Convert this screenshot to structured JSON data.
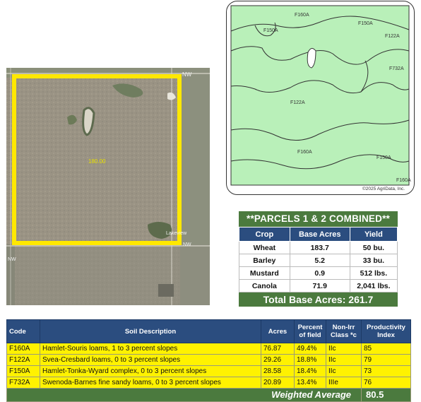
{
  "aerial": {
    "center_label": "180.00",
    "road_labels": [
      "NW",
      "Lakeview",
      "NW",
      "NW"
    ]
  },
  "soil_map": {
    "labels": [
      "F160A",
      "F150A",
      "F122A",
      "F150A",
      "F732A",
      "F122A",
      "F160A",
      "F150A",
      "F160A"
    ],
    "copyright": "©2025 AgriData, Inc."
  },
  "parcels": {
    "title": "**PARCELS 1 & 2 COMBINED**",
    "headers": [
      "Crop",
      "Base Acres",
      "Yield"
    ],
    "rows": [
      [
        "Wheat",
        "183.7",
        "50 bu."
      ],
      [
        "Barley",
        "5.2",
        "33 bu."
      ],
      [
        "Mustard",
        "0.9",
        "512 lbs."
      ],
      [
        "Canola",
        "71.9",
        "2,041 lbs."
      ]
    ],
    "total_label": "Total Base Acres:",
    "total_value": "261.7"
  },
  "soil_table": {
    "headers": {
      "code": "Code",
      "description": "Soil Description",
      "acres": "Acres",
      "percent_line1": "Percent",
      "percent_line2": "of field",
      "class_line1": "Non-Irr",
      "class_line2": "Class *c",
      "productivity_line1": "Productivity",
      "productivity_line2": "Index"
    },
    "rows": [
      [
        "F160A",
        "Hamlet-Souris loams, 1 to 3 percent slopes",
        "76.87",
        "49.4%",
        "IIc",
        "85"
      ],
      [
        "F122A",
        "Svea-Cresbard loams, 0 to 3 percent slopes",
        "29.26",
        "18.8%",
        "IIc",
        "79"
      ],
      [
        "F150A",
        "Hamlet-Tonka-Wyard complex, 0 to 3 percent slopes",
        "28.58",
        "18.4%",
        "IIc",
        "73"
      ],
      [
        "F732A",
        "Swenoda-Barnes fine sandy loams, 0 to 3 percent slopes",
        "20.89",
        "13.4%",
        "IIIe",
        "76"
      ]
    ],
    "weighted_label": "Weighted Average",
    "weighted_value": "80.5"
  },
  "colors": {
    "header_blue": "#2b4d7f",
    "title_green": "#4b7a3e",
    "row_yellow": "#fff200",
    "map_green": "#b9f0b9",
    "boundary_yellow": "#ffe800"
  }
}
